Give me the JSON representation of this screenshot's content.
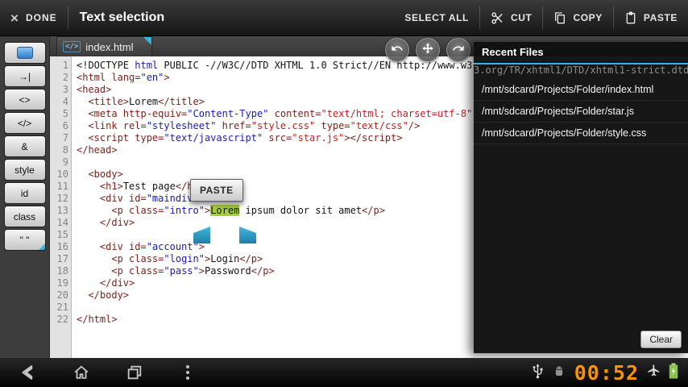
{
  "action_bar": {
    "done_label": "DONE",
    "title": "Text selection",
    "select_all_label": "SELECT ALL",
    "cut_label": "CUT",
    "copy_label": "COPY",
    "paste_label": "PASTE"
  },
  "sidebar": {
    "items": [
      {
        "name": "selection-tool",
        "label": ""
      },
      {
        "name": "tab-key",
        "label": "→|"
      },
      {
        "name": "angle-brackets",
        "label": "<>"
      },
      {
        "name": "close-tag",
        "label": "</>"
      },
      {
        "name": "ampersand",
        "label": "&"
      },
      {
        "name": "style",
        "label": "style"
      },
      {
        "name": "id",
        "label": "id"
      },
      {
        "name": "class",
        "label": "class"
      },
      {
        "name": "quotes",
        "label": "\" \""
      }
    ]
  },
  "tab_bar": {
    "filename": "index.html",
    "icon": "</>"
  },
  "editor": {
    "paste_tooltip": "PASTE",
    "lines": [
      {
        "n": 1,
        "tokens": [
          [
            "k",
            "<!DOCTYPE "
          ],
          [
            "b",
            "html"
          ],
          [
            "k",
            " PUBLIC -//W3C//DTD XHTML 1.0 Strict//EN http://www.w3.org/TR/xhtml1/DTD/xhtml1-strict.dtd"
          ]
        ]
      },
      {
        "n": 2,
        "tokens": [
          [
            "t",
            "<html lang="
          ],
          [
            "b",
            "\"en\""
          ],
          [
            "t",
            ">"
          ]
        ]
      },
      {
        "n": 3,
        "tokens": [
          [
            "t",
            "<head>"
          ]
        ]
      },
      {
        "n": 4,
        "tokens": [
          [
            "k",
            "  "
          ],
          [
            "t",
            "<title>"
          ],
          [
            "k",
            "Lorem"
          ],
          [
            "t",
            "</title>"
          ]
        ]
      },
      {
        "n": 5,
        "tokens": [
          [
            "k",
            "  "
          ],
          [
            "t",
            "<meta http-equiv="
          ],
          [
            "b",
            "\"Content-Type\""
          ],
          [
            "t",
            " content="
          ],
          [
            "r",
            "\"text/html; charset=utf-8\""
          ],
          [
            "t",
            " />"
          ]
        ]
      },
      {
        "n": 6,
        "tokens": [
          [
            "k",
            "  "
          ],
          [
            "t",
            "<link rel="
          ],
          [
            "b",
            "\"stylesheet\""
          ],
          [
            "t",
            " href="
          ],
          [
            "r",
            "\"style.css\""
          ],
          [
            "t",
            " type="
          ],
          [
            "r",
            "\"text/css\""
          ],
          [
            "t",
            "/>"
          ]
        ]
      },
      {
        "n": 7,
        "tokens": [
          [
            "k",
            "  "
          ],
          [
            "t",
            "<script type="
          ],
          [
            "b",
            "\"text/javascript\""
          ],
          [
            "t",
            " src="
          ],
          [
            "r",
            "\"star.js\""
          ],
          [
            "t",
            "></script>"
          ]
        ]
      },
      {
        "n": 8,
        "tokens": [
          [
            "t",
            "</head>"
          ]
        ]
      },
      {
        "n": 9,
        "tokens": []
      },
      {
        "n": 10,
        "tokens": [
          [
            "k",
            "  "
          ],
          [
            "t",
            "<body>"
          ]
        ]
      },
      {
        "n": 11,
        "tokens": [
          [
            "k",
            "    "
          ],
          [
            "t",
            "<h1>"
          ],
          [
            "k",
            "Test page"
          ],
          [
            "t",
            "</h1>"
          ]
        ]
      },
      {
        "n": 12,
        "tokens": [
          [
            "k",
            "    "
          ],
          [
            "t",
            "<div id="
          ],
          [
            "b",
            "\"maindiv\""
          ],
          [
            "t",
            ">"
          ]
        ]
      },
      {
        "n": 13,
        "tokens": [
          [
            "k",
            "      "
          ],
          [
            "t",
            "<p class="
          ],
          [
            "b",
            "\"intro\""
          ],
          [
            "t",
            ">"
          ],
          [
            "sel",
            "Lorem"
          ],
          [
            "k",
            " ipsum dolor sit amet"
          ],
          [
            "t",
            "</p>"
          ]
        ]
      },
      {
        "n": 14,
        "tokens": [
          [
            "k",
            "    "
          ],
          [
            "t",
            "</div>"
          ]
        ]
      },
      {
        "n": 15,
        "tokens": []
      },
      {
        "n": 16,
        "tokens": [
          [
            "k",
            "    "
          ],
          [
            "t",
            "<div id="
          ],
          [
            "b",
            "\"account\""
          ],
          [
            "t",
            ">"
          ]
        ]
      },
      {
        "n": 17,
        "tokens": [
          [
            "k",
            "      "
          ],
          [
            "t",
            "<p class="
          ],
          [
            "b",
            "\"login\""
          ],
          [
            "t",
            ">"
          ],
          [
            "k",
            "Login"
          ],
          [
            "t",
            "</p>"
          ]
        ]
      },
      {
        "n": 18,
        "tokens": [
          [
            "k",
            "      "
          ],
          [
            "t",
            "<p class="
          ],
          [
            "b",
            "\"pass\""
          ],
          [
            "t",
            ">"
          ],
          [
            "k",
            "Password"
          ],
          [
            "t",
            "</p>"
          ]
        ]
      },
      {
        "n": 19,
        "tokens": [
          [
            "k",
            "    "
          ],
          [
            "t",
            "</div>"
          ]
        ]
      },
      {
        "n": 20,
        "tokens": [
          [
            "k",
            "  "
          ],
          [
            "t",
            "</body>"
          ]
        ]
      },
      {
        "n": 21,
        "tokens": []
      },
      {
        "n": 22,
        "tokens": [
          [
            "t",
            "</html>"
          ]
        ]
      }
    ]
  },
  "recent_files": {
    "title": "Recent Files",
    "files": [
      "/mnt/sdcard/Projects/Folder/index.html",
      "/mnt/sdcard/Projects/Folder/star.js",
      "/mnt/sdcard/Projects/Folder/style.css"
    ],
    "clear_label": "Clear",
    "code_overlay": "3.org/TR/xhtml1/DTD/xhtml1-strict.dtd"
  },
  "status_bar": {
    "clock": "00:52"
  },
  "colors": {
    "accent_blue": "#33B5E5",
    "clock_orange": "#FF9100",
    "selection_green": "#A5CE3C",
    "tag_color": "#7E2219",
    "string_blue": "#1A1AB8",
    "string_red": "#C01F1F"
  }
}
